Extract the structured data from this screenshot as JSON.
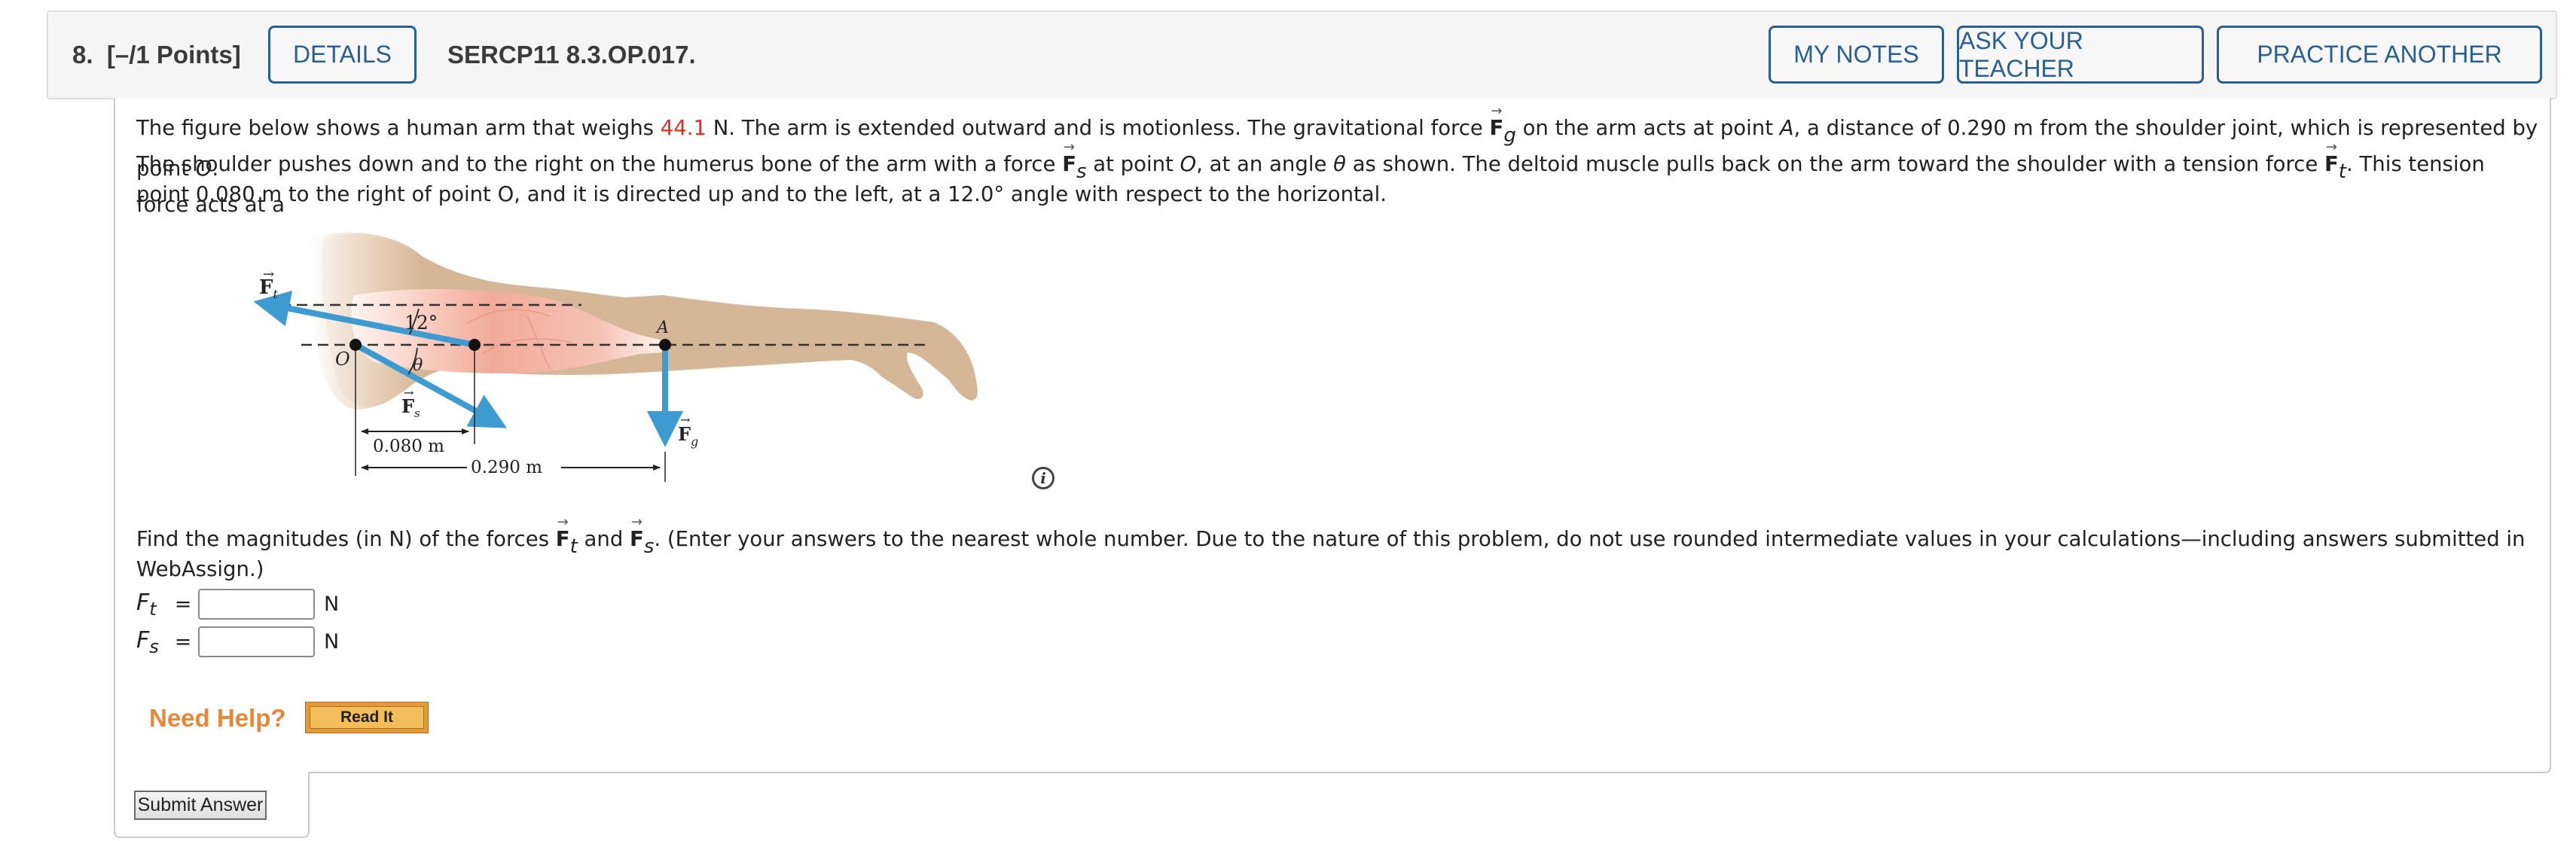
{
  "header": {
    "question_number": "8.",
    "points": "[–/1 Points]",
    "details_label": "DETAILS",
    "question_id": "SERCP11 8.3.OP.017.",
    "my_notes_label": "MY NOTES",
    "ask_teacher_label": "ASK YOUR TEACHER",
    "practice_another_label": "PRACTICE ANOTHER"
  },
  "problem": {
    "p1_a": "The figure below shows a human arm that weighs ",
    "weight_value": "44.1",
    "p1_b": " N. The arm is extended outward and is motionless. The gravitational force ",
    "p1_c": " on the arm acts at point ",
    "point_A": "A",
    "p1_d": ", a distance of 0.290 m from the shoulder joint, which is represented by point ",
    "point_O": "O",
    "p1_e": ".",
    "p2_a": "The shoulder pushes down and to the right on the humerus bone of the arm with a force ",
    "p2_b": " at point ",
    "p2_c": ", at an angle ",
    "theta": "θ",
    "p2_d": " as shown. The deltoid muscle pulls back on the arm toward the shoulder with a tension force ",
    "p2_e": ". This tension force acts at a",
    "p3": "point 0.080 m to the right of point O, and it is directed up and to the left, at a 12.0° angle with respect to the horizontal.",
    "F": "F",
    "sub_g": "g",
    "sub_s": "s",
    "sub_t": "t"
  },
  "figure": {
    "label_Ft": "F",
    "label_Ft_sub": "t",
    "label_Fs": "F",
    "label_Fs_sub": "s",
    "label_Fg": "F",
    "label_Fg_sub": "g",
    "label_angle_12": "12°",
    "label_theta": "θ",
    "label_O": "O",
    "label_A": "A",
    "dim_short": "0.080 m",
    "dim_long": "0.290 m",
    "arrow_color": "#3d9bd0",
    "skin_color": "#d5b797",
    "muscle_color": "#f0b4a6"
  },
  "instructions": {
    "a": "Find the magnitudes (in N) of the forces ",
    "and": " and ",
    "b": ". (Enter your answers to the nearest whole number. Due to the nature of this problem, do not use rounded intermediate values in your calculations—including answers submitted in",
    "c": "WebAssign.)"
  },
  "answers": [
    {
      "label": "F",
      "sub": "t",
      "eq": "=",
      "value": "",
      "unit": "N"
    },
    {
      "label": "F",
      "sub": "s",
      "eq": "=",
      "value": "",
      "unit": "N"
    }
  ],
  "help": {
    "need_help": "Need Help?",
    "read_it": "Read It"
  },
  "submit_label": "Submit Answer",
  "info_icon_glyph": "i"
}
